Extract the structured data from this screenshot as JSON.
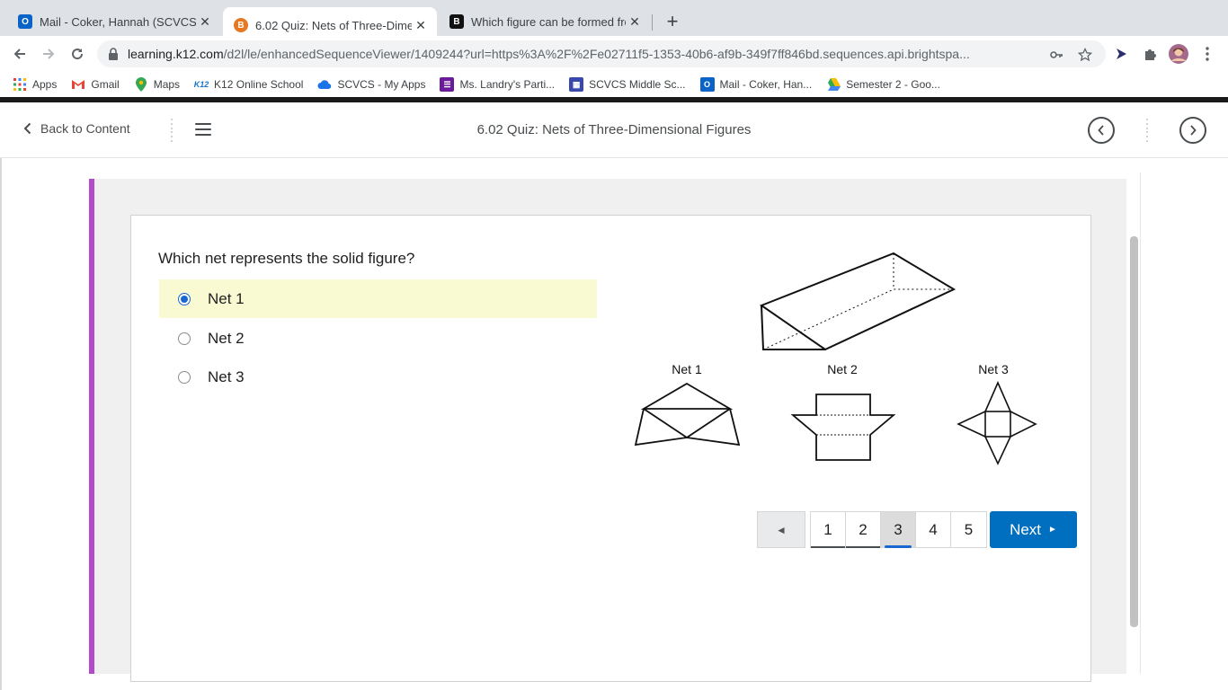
{
  "browser": {
    "tabs": [
      {
        "title": "Mail - Coker, Hannah (SCVCS S",
        "favicon": "outlook-icon",
        "active": false
      },
      {
        "title": "6.02 Quiz: Nets of Three-Dime",
        "favicon": "brightspace-icon",
        "active": true
      },
      {
        "title": "Which figure can be formed fro",
        "favicon": "brainly-icon",
        "active": false
      }
    ],
    "url_host": "learning.k12.com",
    "url_path": "/d2l/le/enhancedSequenceViewer/1409244?url=https%3A%2F%2Fe02711f5-1353-40b6-af9b-349f7ff846bd.sequences.api.brightspa...",
    "bookmarks": [
      {
        "label": "Apps",
        "icon": "apps-grid-icon"
      },
      {
        "label": "Gmail",
        "icon": "gmail-icon"
      },
      {
        "label": "Maps",
        "icon": "maps-icon"
      },
      {
        "label": "K12 Online School",
        "icon": "k12-icon"
      },
      {
        "label": "SCVCS - My Apps",
        "icon": "cloud-icon"
      },
      {
        "label": "Ms. Landry's Parti...",
        "icon": "list-icon"
      },
      {
        "label": "SCVCS Middle Sc...",
        "icon": "calendar-icon"
      },
      {
        "label": "Mail - Coker, Han...",
        "icon": "outlook-icon"
      },
      {
        "label": "Semester 2 - Goo...",
        "icon": "drive-icon"
      }
    ]
  },
  "nav": {
    "back_label": "Back to Content",
    "title": "6.02 Quiz: Nets of Three-Dimensional Figures"
  },
  "quiz": {
    "question": "Which net represents the solid figure?",
    "options": [
      {
        "label": "Net 1",
        "selected": true
      },
      {
        "label": "Net 2",
        "selected": false
      },
      {
        "label": "Net 3",
        "selected": false
      }
    ],
    "figure_labels": [
      "Net 1",
      "Net 2",
      "Net 3"
    ]
  },
  "pagination": {
    "prev_symbol": "◄",
    "pages": [
      "1",
      "2",
      "3",
      "4",
      "5"
    ],
    "current_page": "3",
    "next_label": "Next",
    "next_symbol": "►"
  },
  "colors": {
    "accent": "#b14bc9",
    "primary_button": "#006fbf",
    "selected_option": "#fafad2"
  }
}
